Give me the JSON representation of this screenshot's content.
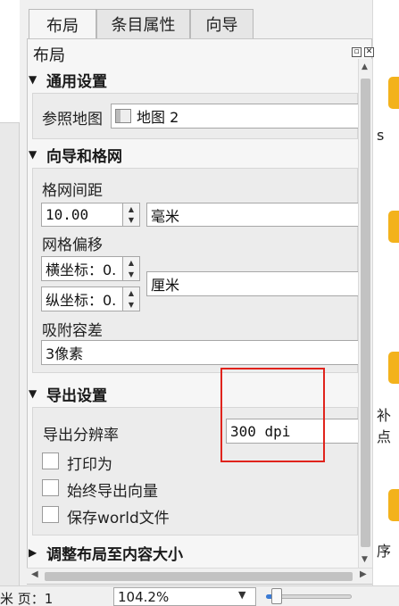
{
  "tabs": [
    {
      "label": "布局"
    },
    {
      "label": "条目属性"
    },
    {
      "label": "向导"
    }
  ],
  "panel": {
    "title": "布局"
  },
  "general": {
    "header": "通用设置",
    "ref_map_label": "参照地图",
    "ref_map_value": "地图 2"
  },
  "guides": {
    "header": "向导和格网",
    "grid_spacing_label": "格网间距",
    "grid_spacing_value": "10.00",
    "grid_spacing_unit": "毫米",
    "grid_offset_label": "网格偏移",
    "offset_x": "横坐标：0.",
    "offset_y": "纵坐标：0.",
    "offset_unit": "厘米",
    "snap_label": "吸附容差",
    "snap_value": "3像素"
  },
  "export": {
    "header": "导出设置",
    "resolution_label": "导出分辨率",
    "resolution_value": "300 dpi",
    "print_as": "打印为",
    "always_vector": "始终导出向量",
    "save_world": "保存world文件"
  },
  "resize": {
    "header": "调整布局至内容大小"
  },
  "status": {
    "page_label": "米 页：1",
    "zoom_value": "104.2%",
    "zoom_fraction": 0.05
  },
  "right_strip": {
    "text_a": "s",
    "text_b": "补点",
    "text_c": "序"
  }
}
